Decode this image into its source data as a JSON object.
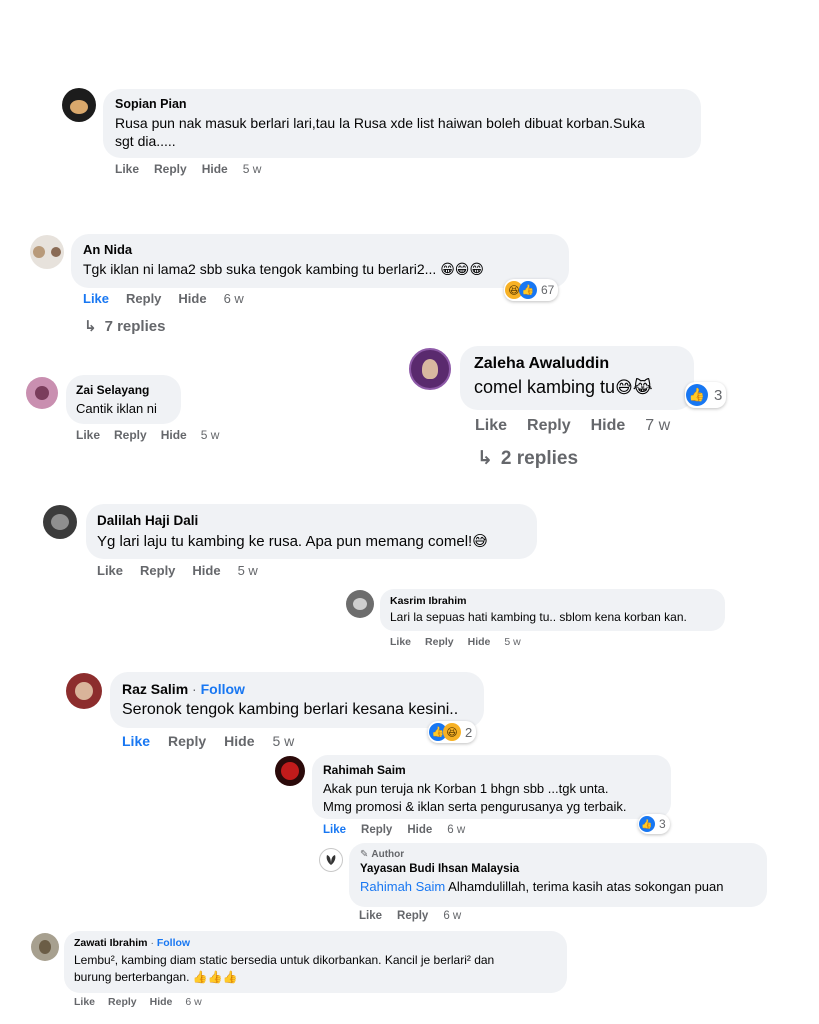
{
  "colors": {
    "link": "#1877f2",
    "meta": "#65676b",
    "bubble": "#f0f2f5",
    "haha": "#f7b125"
  },
  "actions": {
    "like": "Like",
    "reply": "Reply",
    "hide": "Hide"
  },
  "comments": [
    {
      "author": "Sopian Pian",
      "text1": "Rusa pun nak masuk berlari lari,tau la Rusa xde list haiwan boleh dibuat korban.Suka",
      "text2": "sgt dia.....",
      "time": "5 w"
    },
    {
      "author": "An Nida",
      "text": "Tgk iklan ni lama2 sbb suka tengok kambing tu berlari2...",
      "emoji": "😁😁😁",
      "time": "6 w",
      "reactions": "67",
      "replies": "7 replies"
    },
    {
      "author": "Zai Selayang",
      "text": "Cantik iklan ni",
      "time": "5 w"
    },
    {
      "author": "Zaleha Awaluddin",
      "text": "comel kambing tu",
      "emoji": "😅😹",
      "time": "7 w",
      "reactions": "3",
      "replies": "2 replies"
    },
    {
      "author": "Dalilah Haji Dali",
      "text": "Yg lari laju tu kambing ke rusa. Apa pun memang comel!",
      "emoji": "😅",
      "time": "5 w"
    },
    {
      "author": "Kasrim Ibrahim",
      "text": "Lari la sepuas hati kambing tu.. sblom kena korban kan.",
      "time": "5 w"
    },
    {
      "author": "Raz Salim",
      "follow": "Follow",
      "dot": "·",
      "text": "Seronok tengok kambing berlari kesana kesini..",
      "time": "5 w",
      "reactions": "2"
    },
    {
      "author": "Rahimah Saim",
      "text1": "Akak pun teruja nk Korban 1 bhgn sbb ...tgk unta.",
      "text2": "Mmg promosi & iklan serta pengurusanya yg terbaik.",
      "time": "6 w",
      "reactions": "3"
    },
    {
      "badge": "Author",
      "author": "Yayasan Budi Ihsan Malaysia",
      "mention": "Rahimah Saim",
      "text": " Alhamdulillah, terima kasih atas sokongan puan",
      "time": "6 w"
    },
    {
      "author": "Zawati Ibrahim",
      "follow": "Follow",
      "dot": "·",
      "text1": "Lembu², kambing diam static bersedia untuk dikorbankan. Kancil je berlari² dan",
      "text2": "burung berterbangan.",
      "emoji": "👍👍👍",
      "time": "6 w"
    }
  ]
}
